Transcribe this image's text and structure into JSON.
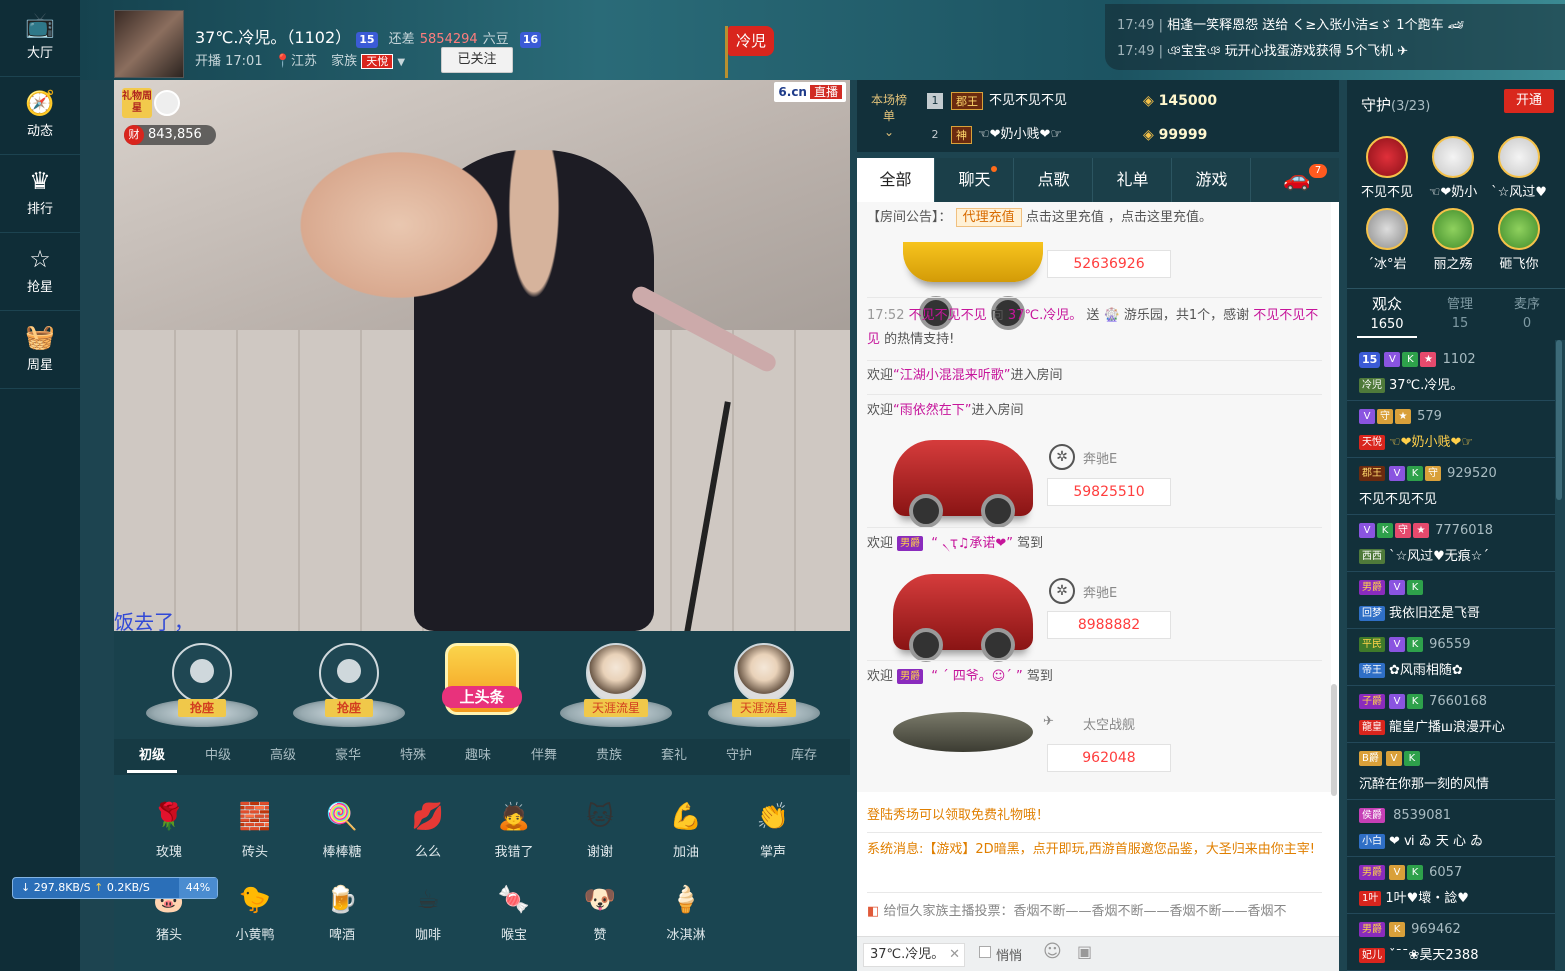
{
  "nav": {
    "items": [
      {
        "icon": "tv-icon",
        "label": "大厅"
      },
      {
        "icon": "compass-icon",
        "label": "动态"
      },
      {
        "icon": "crown-icon",
        "label": "排行"
      },
      {
        "icon": "star-icon",
        "label": "抢星"
      },
      {
        "icon": "gift-basket-icon",
        "label": "周星"
      }
    ]
  },
  "anchor": {
    "name": "37℃.冷児。（1102）",
    "level_badge": "15",
    "diff_label": "还差",
    "diff_value": "5854294",
    "diff_unit": "六豆",
    "next_level": "16",
    "start_label": "开播 17:01",
    "location": "江苏",
    "family_label": "家族",
    "family_tag": "天悅",
    "follow_label": "已关注",
    "flag_text": "冷児"
  },
  "notices": [
    {
      "time": "17:49",
      "text": "相逢一笑释恩怨 送给 く≥入张小洁≤ゞ 1个跑车"
    },
    {
      "time": "17:49",
      "text": "ঞ宝宝ঞ 玩开心找蛋游戏获得 5个飞机"
    }
  ],
  "video": {
    "logo": "6.cn",
    "live_label": "直播",
    "gift_star": "礼物周星",
    "wealth_label": "财",
    "wealth_value": "843,856",
    "danmu": "饭去了，"
  },
  "seats": [
    {
      "label": "抢座",
      "type": "empty"
    },
    {
      "label": "抢座",
      "type": "empty"
    },
    {
      "label": "上头条",
      "type": "headline"
    },
    {
      "label": "天涯流星",
      "type": "user"
    },
    {
      "label": "天涯流星",
      "type": "user"
    }
  ],
  "gift_tabs": [
    "初级",
    "中级",
    "高级",
    "豪华",
    "特殊",
    "趣味",
    "伴舞",
    "贵族",
    "套礼",
    "守护",
    "库存"
  ],
  "gifts": [
    {
      "name": "玫瑰",
      "glyph": "🌹"
    },
    {
      "name": "砖头",
      "glyph": "🧱"
    },
    {
      "name": "棒棒糖",
      "glyph": "🍭"
    },
    {
      "name": "么么",
      "glyph": "💋"
    },
    {
      "name": "我错了",
      "glyph": "🙇"
    },
    {
      "name": "谢谢",
      "glyph": "🐱"
    },
    {
      "name": "加油",
      "glyph": "💪"
    },
    {
      "name": "掌声",
      "glyph": "👏"
    },
    {
      "name": "猪头",
      "glyph": "🐷"
    },
    {
      "name": "小黄鸭",
      "glyph": "🐤"
    },
    {
      "name": "啤酒",
      "glyph": "🍺"
    },
    {
      "name": "咖啡",
      "glyph": "☕"
    },
    {
      "name": "喉宝",
      "glyph": "🍬"
    },
    {
      "name": "赞",
      "glyph": "🐶"
    },
    {
      "name": "冰淇淋",
      "glyph": "🍦"
    }
  ],
  "net": {
    "down": "297.8KB/S",
    "up": "0.2KB/S",
    "pct": "44%"
  },
  "rank": {
    "title": "本场榜单",
    "rows": [
      {
        "num": "1",
        "tag": "郡王",
        "name": "不见不见不见",
        "coins": "145000"
      },
      {
        "num": "2",
        "tag": "神",
        "name": "☜❤奶小贱❤☞",
        "coins": "99999"
      }
    ]
  },
  "chat_tabs": [
    "全部",
    "聊天",
    "点歌",
    "礼单",
    "游戏"
  ],
  "car_count": "7",
  "chat": {
    "notice_prefix": "【房间公告】：",
    "notice_tag": "代理充值",
    "notice_text": "点击这里充值 ，点击这里充值。",
    "amount0": "52636926",
    "gift_time": "17:52",
    "gift_from": "不见不见不见",
    "gift_to_word": "向",
    "gift_to": "37℃.冷児。",
    "gift_send": "送",
    "gift_item": "游乐园，共1个，感谢",
    "gift_thanks_name": "不见不见不见",
    "gift_tail": "的热情支持!",
    "welcome1_pre": "欢迎",
    "welcome1_name": "“江湖小混混来听歌”",
    "welcome1_post": "进入房间",
    "welcome2_name": "“雨依然在下”",
    "car1_brand": "奔驰E",
    "car1_amount": "59825510",
    "welcome3_tag": "男爵",
    "welcome3_name": "“ ৲ҭ♫承诺❤”",
    "welcome3_post": "驾到",
    "car2_brand": "奔驰E",
    "car2_amount": "8988882",
    "welcome4_name": "“ ˊ 四爷。☺ˊ ”",
    "car3_brand": "太空战舰",
    "car3_amount": "962048",
    "sys1": "登陆秀场可以领取免费礼物哦！",
    "sys2": "系统消息:【游戏】2D暗黑，点开即玩,西游首服邀您品鉴，大圣归来由你主宰!",
    "sys3": "给恒久家族主播投票：香烟不断——香烟不断——香烟不断——香烟不"
  },
  "chat_input": {
    "target": "37℃.冷児。",
    "whisper": "悄悄"
  },
  "guard": {
    "title": "守护",
    "count": "(3/23)",
    "open": "开通",
    "members": [
      "不见不见",
      "☜❤奶小",
      "ˋ☆风过♥",
      "ˊ冰°岩",
      "丽之殇",
      "砸飞你"
    ]
  },
  "audience_tabs": [
    {
      "label": "观众",
      "count": "1650"
    },
    {
      "label": "管理",
      "count": "15"
    },
    {
      "label": "麦序",
      "count": "0"
    }
  ],
  "audience": [
    {
      "id": "1102",
      "name": "37℃.冷児。",
      "tag": "冷児"
    },
    {
      "id": "579",
      "name": "☜❤奶小贱❤☞",
      "tag": "天悅"
    },
    {
      "id": "929520",
      "name": "不见不见不见",
      "tag": "郡王"
    },
    {
      "id": "7776018",
      "name": "ˋ☆风过♥无痕☆ˊ",
      "tag": "西西"
    },
    {
      "id": "",
      "name": "我依旧还是飞哥",
      "tag": "回梦"
    },
    {
      "id": "96559",
      "name": "✿风雨相随✿",
      "tag": "帝王"
    },
    {
      "id": "7660168",
      "name": "龍皇广播ш浪漫开心",
      "tag": "龍皇"
    },
    {
      "id": "",
      "name": "沉醉在你那一刻的风情",
      "tag": "B爵"
    },
    {
      "id": "8539081",
      "name": "❤ ⅵ ゐ 天 心 ゐ",
      "tag": "小白"
    },
    {
      "id": "6057",
      "name": "1叶♥壞・諗♥",
      "tag": "1叶"
    },
    {
      "id": "969462",
      "name": "ˇ¯¯❀昊天2388",
      "tag": "妃儿"
    }
  ]
}
